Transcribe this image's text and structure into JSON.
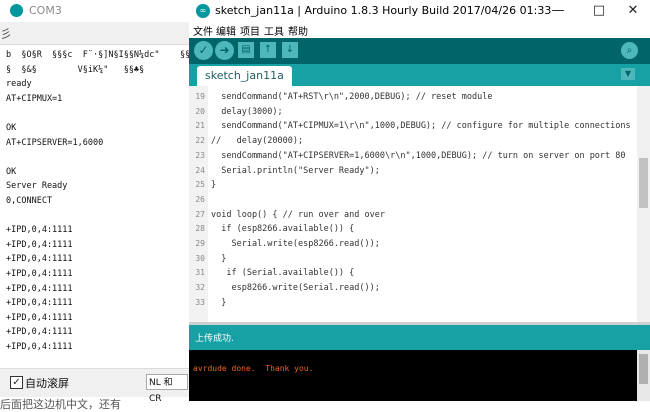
{
  "serial_monitor": {
    "title": "COM3",
    "edge_glyph": "彡",
    "lines": [
      "b  §O§R  §§§c  F¨·§]N§I§§N¼dc\"    §§",
      "§  §&§        V§iK¼\"   §§♣§",
      "ready",
      "AT+CIPMUX=1",
      "",
      "OK",
      "AT+CIPSERVER=1,6000",
      "",
      "OK",
      "Server Ready",
      "0,CONNECT",
      "",
      "+IPD,0,4:1111",
      "+IPD,0,4:1111",
      "+IPD,0,4:1111",
      "+IPD,0,4:1111",
      "+IPD,0,4:1111",
      "+IPD,0,4:1111",
      "+IPD,0,4:1111",
      "+IPD,0,4:1111",
      "+IPD,0,4:1111"
    ],
    "autoscroll_label": "自动滚屏",
    "autoscroll_checked": true,
    "line_ending": "NL 和 CR",
    "bottom_caption": "后面把这边机中文，还有"
  },
  "ide": {
    "title": "sketch_jan11a | Arduino 1.8.3 Hourly Build 2017/04/26 01:33",
    "window_buttons": {
      "minimize": "—",
      "maximize": "□",
      "close": "✕"
    },
    "menus": [
      "文件",
      "编辑",
      "项目",
      "工具",
      "帮助"
    ],
    "toolbar_icons": [
      "verify-icon",
      "upload-icon",
      "new-icon",
      "open-icon",
      "save-icon"
    ],
    "serial_monitor_icon": "magnifier-icon",
    "tab": "sketch_jan11a",
    "code_lines": [
      {
        "n": "19",
        "text": "  sendCommand(\"AT+RST\\r\\n\",2000,DEBUG); // reset module"
      },
      {
        "n": "20",
        "text": "  delay(3000);"
      },
      {
        "n": "21",
        "text": "  sendCommand(\"AT+CIPMUX=1\\r\\n\",1000,DEBUG); // configure for multiple connections"
      },
      {
        "n": "22",
        "text": "//   delay(20000);"
      },
      {
        "n": "23",
        "text": "  sendCommand(\"AT+CIPSERVER=1,6000\\r\\n\",1000,DEBUG); // turn on server on port 80"
      },
      {
        "n": "24",
        "text": "  Serial.println(\"Server Ready\");"
      },
      {
        "n": "25",
        "text": "}"
      },
      {
        "n": "26",
        "text": ""
      },
      {
        "n": "27",
        "text": "void loop() { // run over and over"
      },
      {
        "n": "28",
        "text": "  if (esp8266.available()) {"
      },
      {
        "n": "29",
        "text": "    Serial.write(esp8266.read());"
      },
      {
        "n": "30",
        "text": "  }"
      },
      {
        "n": "31",
        "text": "   if (Serial.available()) {"
      },
      {
        "n": "32",
        "text": "    esp8266.write(Serial.read());"
      },
      {
        "n": "33",
        "text": "  }"
      }
    ],
    "status": "上传成功.",
    "console": "avrdude done.  Thank you."
  },
  "colors": {
    "arduino_teal_dark": "#006468",
    "arduino_teal": "#17a1a5",
    "console_text": "#e8651f"
  }
}
